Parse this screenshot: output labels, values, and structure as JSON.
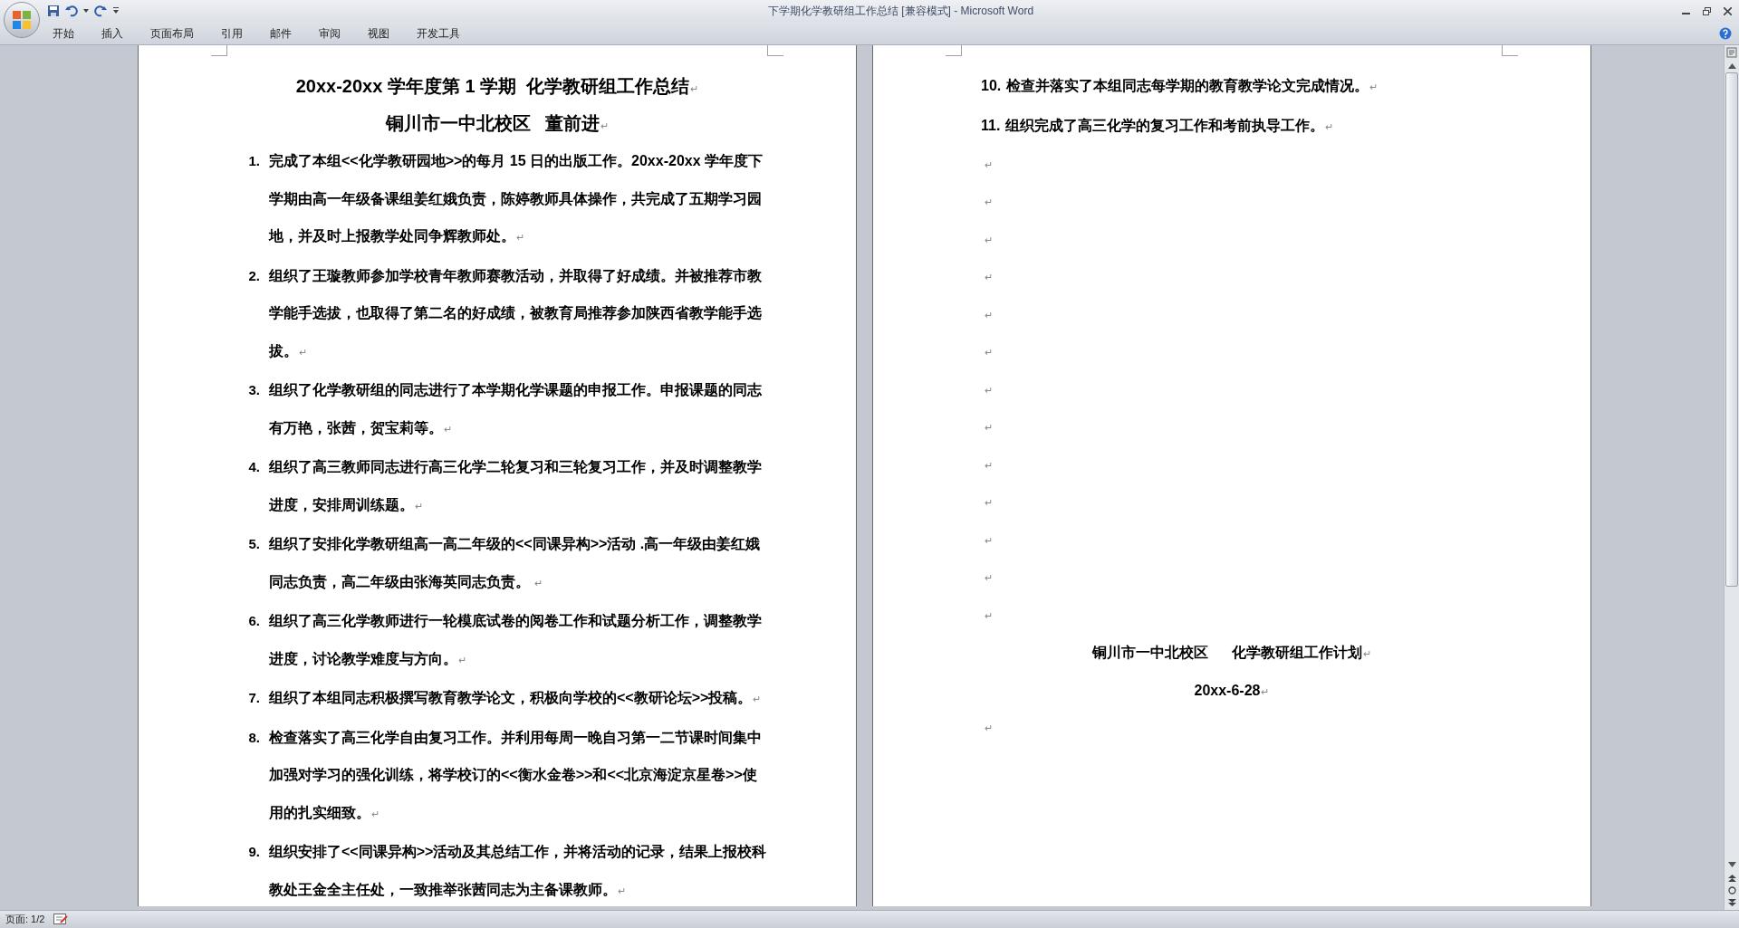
{
  "window": {
    "title": "下学期化学教研组工作总结 [兼容模式] - Microsoft Word"
  },
  "ribbon_tabs": [
    "开始",
    "插入",
    "页面布局",
    "引用",
    "邮件",
    "审阅",
    "视图",
    "开发工具"
  ],
  "paragraph_mark": "↵",
  "pages": [
    {
      "paragraphs": [
        {
          "kind": "title",
          "text": "20xx-20xx 学年度第 1 学期  化学教研组工作总结"
        },
        {
          "kind": "title",
          "text": "铜川市一中北校区   董前进"
        },
        {
          "kind": "item",
          "number": "1.",
          "text": "完成了本组<<化学教研园地>>的每月 15 日的出版工作。20xx-20xx 学年度下学期由高一年级备课组姜红娥负责，陈婷教师具体操作，共完成了五期学习园地，并及时上报教学处同争辉教师处。"
        },
        {
          "kind": "item",
          "number": "2.",
          "text": "组织了王璇教师参加学校青年教师赛教活动，并取得了好成绩。并被推荐市教学能手选拔，也取得了第二名的好成绩，被教育局推荐参加陕西省教学能手选拔。"
        },
        {
          "kind": "item",
          "number": "3.",
          "text": "组织了化学教研组的同志进行了本学期化学课题的申报工作。申报课题的同志有万艳，张茜，贺宝莉等。"
        },
        {
          "kind": "item",
          "number": "4.",
          "text": "组织了高三教师同志进行高三化学二轮复习和三轮复习工作，并及时调整教学进度，安排周训练题。"
        },
        {
          "kind": "item",
          "number": "5.",
          "text": "组织了安排化学教研组高一高二年级的<<同课异构>>活动 .高一年级由姜红娥同志负责，高二年级由张海英同志负责。 "
        },
        {
          "kind": "item",
          "number": "6.",
          "text": "组织了高三化学教师进行一轮模底试卷的阅卷工作和试题分析工作，调整教学进度，讨论教学难度与方向。"
        },
        {
          "kind": "item",
          "number": "7.",
          "text": "组织了本组同志积极撰写教育教学论文，积极向学校的<<教研论坛>>投稿。"
        },
        {
          "kind": "item",
          "number": "8.",
          "text": "检查落实了高三化学自由复习工作。并利用每周一晚自习第一二节课时间集中加强对学习的强化训练，将学校订的<<衡水金卷>>和<<北京海淀京星卷>>使用的扎实细致。"
        },
        {
          "kind": "item",
          "number": "9.",
          "text": "组织安排了<<同课异构>>活动及其总结工作，并将活动的记录，结果上报校科教处王金全主任处，一致推举张茜同志为主备课教师。"
        }
      ]
    },
    {
      "paragraphs": [
        {
          "kind": "inline",
          "number": "10.",
          "text": "检查并落实了本组同志每学期的教育教学论文完成情况。"
        },
        {
          "kind": "inline",
          "number": "11.",
          "text": "组织完成了高三化学的复习工作和考前执导工作。"
        },
        {
          "kind": "empty"
        },
        {
          "kind": "empty"
        },
        {
          "kind": "empty"
        },
        {
          "kind": "empty"
        },
        {
          "kind": "empty"
        },
        {
          "kind": "empty"
        },
        {
          "kind": "empty"
        },
        {
          "kind": "empty"
        },
        {
          "kind": "empty"
        },
        {
          "kind": "empty"
        },
        {
          "kind": "empty"
        },
        {
          "kind": "empty"
        },
        {
          "kind": "empty"
        },
        {
          "kind": "center",
          "text": "铜川市一中北校区      化学教研组工作计划"
        },
        {
          "kind": "center",
          "text": "20xx-6-28"
        },
        {
          "kind": "empty"
        }
      ]
    }
  ],
  "status_bar": {
    "page": "页面: 1/2"
  }
}
